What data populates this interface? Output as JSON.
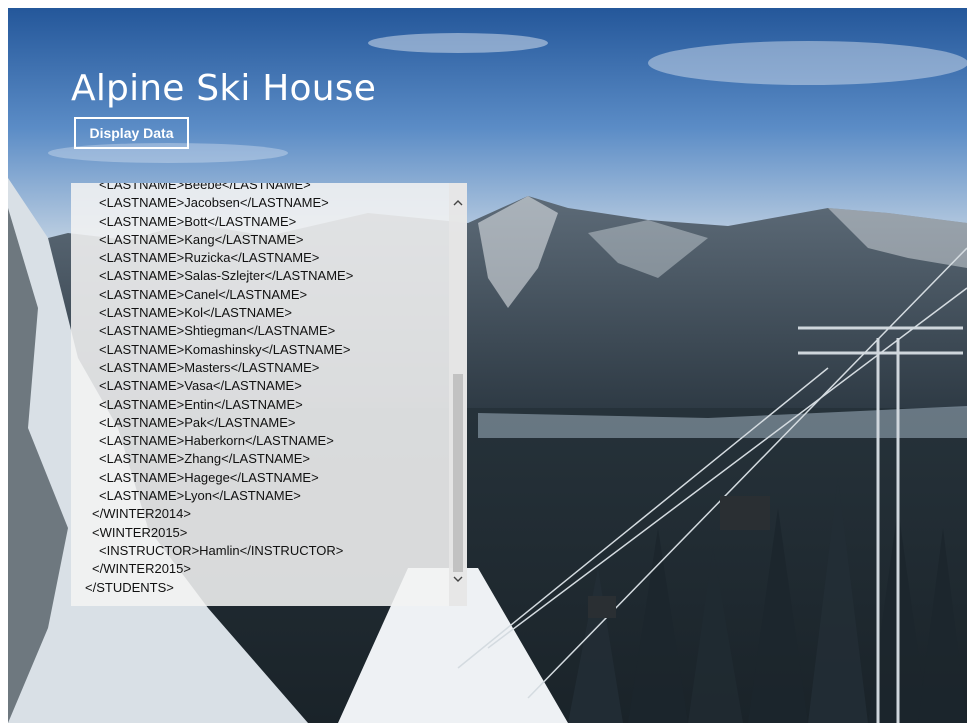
{
  "app": {
    "title": "Alpine Ski House"
  },
  "toolbar": {
    "display_label": "Display Data"
  },
  "xml": {
    "lines": [
      {
        "text": "<LASTNAME>Beebe</LASTNAME>",
        "indent": 2
      },
      {
        "text": "<LASTNAME>Jacobsen</LASTNAME>",
        "indent": 2
      },
      {
        "text": "<LASTNAME>Bott</LASTNAME>",
        "indent": 2
      },
      {
        "text": "<LASTNAME>Kang</LASTNAME>",
        "indent": 2
      },
      {
        "text": "<LASTNAME>Ruzicka</LASTNAME>",
        "indent": 2
      },
      {
        "text": "<LASTNAME>Salas-Szlejter</LASTNAME>",
        "indent": 2
      },
      {
        "text": "<LASTNAME>Canel</LASTNAME>",
        "indent": 2
      },
      {
        "text": "<LASTNAME>Kol</LASTNAME>",
        "indent": 2
      },
      {
        "text": "<LASTNAME>Shtiegman</LASTNAME>",
        "indent": 2
      },
      {
        "text": "<LASTNAME>Komashinsky</LASTNAME>",
        "indent": 2
      },
      {
        "text": "<LASTNAME>Masters</LASTNAME>",
        "indent": 2
      },
      {
        "text": "<LASTNAME>Vasa</LASTNAME>",
        "indent": 2
      },
      {
        "text": "<LASTNAME>Entin</LASTNAME>",
        "indent": 2
      },
      {
        "text": "<LASTNAME>Pak</LASTNAME>",
        "indent": 2
      },
      {
        "text": "<LASTNAME>Haberkorn</LASTNAME>",
        "indent": 2
      },
      {
        "text": "<LASTNAME>Zhang</LASTNAME>",
        "indent": 2
      },
      {
        "text": "<LASTNAME>Hagege</LASTNAME>",
        "indent": 2
      },
      {
        "text": "<LASTNAME>Lyon</LASTNAME>",
        "indent": 2
      },
      {
        "text": "</WINTER2014>",
        "indent": 1
      },
      {
        "text": "<WINTER2015>",
        "indent": 1
      },
      {
        "text": "<INSTRUCTOR>Hamlin</INSTRUCTOR>",
        "indent": 2
      },
      {
        "text": "</WINTER2015>",
        "indent": 1
      },
      {
        "text": "</STUDENTS>",
        "indent": 0
      }
    ]
  },
  "scroll": {
    "position": 0.45
  },
  "icons": {
    "scroll_up": "chevron-up-icon",
    "scroll_down": "chevron-down-icon"
  }
}
